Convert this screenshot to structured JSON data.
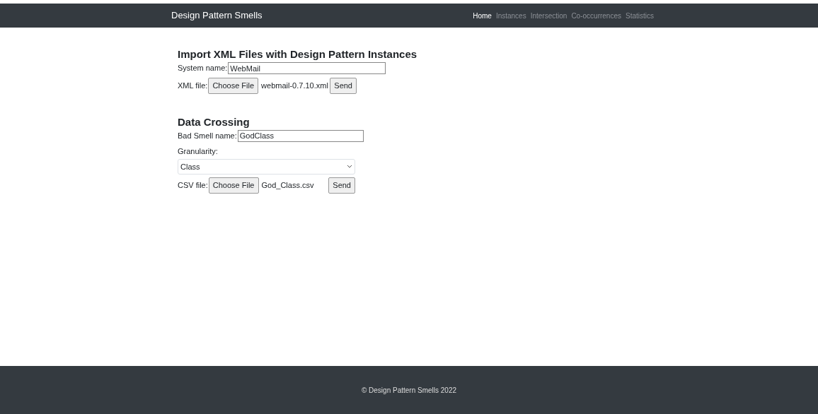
{
  "navbar": {
    "brand": "Design Pattern Smells",
    "links": [
      {
        "label": "Home",
        "selected": true
      },
      {
        "label": "Instances",
        "selected": false
      },
      {
        "label": "Intersection",
        "selected": false
      },
      {
        "label": "Co-occurrences",
        "selected": false
      },
      {
        "label": "Statistics",
        "selected": false
      }
    ]
  },
  "import_section": {
    "title": "Import XML Files with Design Pattern Instances",
    "system_name_label": "System name:",
    "system_name_value": "WebMail",
    "file_label": "XML file:",
    "choose_button": "Choose File",
    "file_name": "webmail-0.7.10.xml",
    "send_button": "Send"
  },
  "crossing_section": {
    "title": "Data Crossing",
    "bad_smell_label": "Bad Smell name:",
    "bad_smell_value": "GodClass",
    "granularity_label": "Granularity:",
    "granularity_value": "Class",
    "file_label": "CSV file:",
    "choose_button": "Choose File",
    "file_name": "God_Class.csv",
    "send_button": "Send"
  },
  "footer": {
    "text": "© Design Pattern Smells 2022"
  }
}
